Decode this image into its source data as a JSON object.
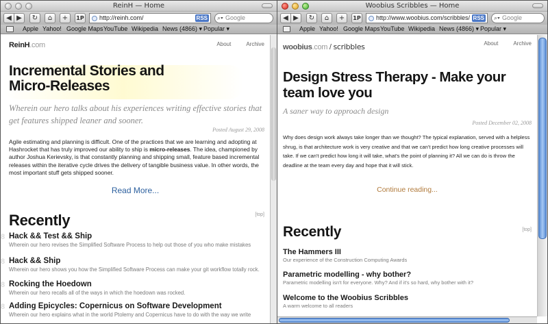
{
  "left": {
    "title": "ReinH — Home",
    "url": "http://reinh.com/",
    "search_placeholder": "Google",
    "rss": "RSS",
    "bookmarks": [
      "Apple",
      "Yahoo!",
      "Google Maps",
      "YouTube",
      "Wikipedia",
      "News (4866) ▾",
      "Popular ▾"
    ],
    "blog": {
      "logo_main": "ReinH",
      "logo_suffix": ".com",
      "nav": [
        "About",
        "Archive"
      ],
      "post_title": "Incremental Stories and Micro-Releases",
      "post_subtitle": "Wherein our hero talks about his experiences writing effective stories that get features shipped leaner and sooner.",
      "posted": "Posted August 29, 2008",
      "body_a": "Agile estimating and planning is difficult. One of the practices that we are learning and adopting at Hashrocket that has truly improved our ability to ship is ",
      "body_strong": "micro-releases",
      "body_b": ". The idea, championed by author Joshua Kerievsky, is that constantly planning and shipping small, feature based incremental releases within the iterative cycle drives the delivery of tangible business value. In other words, the most important stuff gets shipped sooner.",
      "read_more": "Read More...",
      "recently": "Recently",
      "top": "[top]",
      "items": [
        {
          "title": "Hack && Test && Ship",
          "desc": "Wherein our hero revises the Simplified Software Process to help out those of you who make mistakes"
        },
        {
          "title": "Hack && Ship",
          "desc": "Wherein our hero shows you how the Simplified Software Process can make your git workflow totally rock."
        },
        {
          "title": "Rocking the Hoedown",
          "desc": "Wherein our hero recalls all of the ways in which the hoedown was rocked."
        },
        {
          "title": "Adding Epicycles: Copernicus on Software Development",
          "desc": "Wherein our hero explains what in the world Ptolemy and Copernicus have to do with the way we write"
        }
      ]
    }
  },
  "right": {
    "title": "Woobius Scribbles — Home",
    "url": "http://www.woobius.com/scribbles/",
    "search_placeholder": "Google",
    "rss": "RSS",
    "bookmarks": [
      "Apple",
      "Yahoo!",
      "Google Maps",
      "YouTube",
      "Wikipedia",
      "News (4866) ▾",
      "Popular ▾"
    ],
    "blog": {
      "logo_main": "woobius",
      "logo_dotcom": ".com",
      "logo_sep": " / ",
      "logo_sub": "scribbles",
      "nav": [
        "About",
        "Archive"
      ],
      "post_title": "Design Stress Therapy - Make your team love you",
      "post_subtitle": "A saner way to approach design",
      "posted": "Posted December 02, 2008",
      "body": "Why does design work always take longer than we thought? The typical explanation, served with a helpless shrug, is that architecture work is very creative and that we can't predict how long creative processes will take. If we can't predict how long it will take, what's the point of planning it? All we can do is throw the deadline at the team every day and hope that it will stick.",
      "continue": "Continue reading...",
      "recently": "Recently",
      "top": "[top]",
      "items": [
        {
          "title": "The Hammers III",
          "desc": "Our experience of the Construction Computing Awards"
        },
        {
          "title": "Parametric modelling - why bother?",
          "desc": "Parametric modelling isn't for everyone. Why? And if it's so hard, why bother with it?"
        },
        {
          "title": "Welcome to the Woobius Scribbles",
          "desc": "A warm welcome to all readers"
        }
      ]
    }
  },
  "colors": {
    "read_more": "#2b5f9e",
    "continue": "#b0793a",
    "woobius_brand": "#7a7a7a"
  },
  "icons": [
    "back-arrow-icon",
    "forward-arrow-icon",
    "reload-icon",
    "snapback-icon",
    "add-bookmark-icon",
    "1p-icon",
    "magnifier-icon",
    "bookmarks-book-icon",
    "favicon-icon"
  ]
}
